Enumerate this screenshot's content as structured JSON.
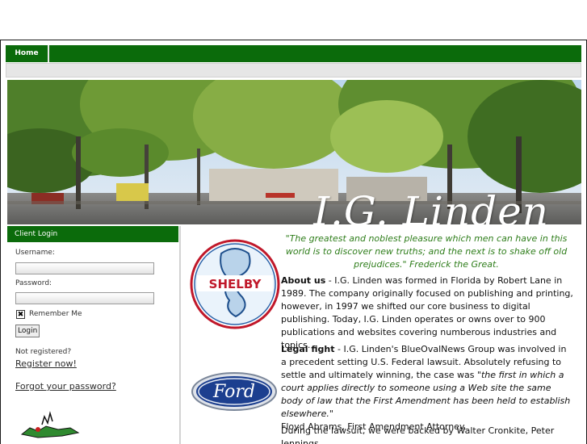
{
  "nav": {
    "home_label": "Home"
  },
  "banner": {
    "title": "I.G. Linden"
  },
  "login": {
    "header": "Client Login",
    "username_label": "Username:",
    "password_label": "Password:",
    "remember_label": "Remember Me",
    "remember_checked": true,
    "login_button": "Login",
    "not_registered": "Not registered?",
    "register_link": "Register now!",
    "forgot_link": "Forgot your password?"
  },
  "content": {
    "quote": "\"The greatest and noblest pleasure which men can have in this world is to discover new truths; and the next is to shake off old prejudices.\" Frederick the Great.",
    "about_heading": "About us",
    "about_text": " - I.G. Linden was formed in Florida by Robert Lane in 1989. The company originally focused on publishing and printing, however, in 1997 we shifted our core business to digital publishing. Today, I.G. Linden operates or owns over to 900 publications and websites covering numberous industries and topics.",
    "legal_heading": "Legal fight",
    "legal_text": " - I.G. Linden's BlueOvalNews Group was involved in a precedent setting U.S. Federal lawsuit. Absolutely refusing to settle and ultimately winning, the case was ",
    "legal_quote": "\"the first in which a court applies directly to someone using a Web site the same body of law that the First Amendment has been held to establish elsewhere.\"",
    "legal_attribution": "Floyd Abrams, First Amendment Attorney.",
    "lawsuit_text": "During the lawsuit, we were backed by Walter Cronkite, Peter Jennings,",
    "shelby_logo_text": "SHELBY",
    "ford_logo_text": "Ford"
  },
  "colors": {
    "nav_green": "#0b6b0b",
    "quote_green": "#2e7d1a"
  },
  "icons": {
    "remember_check": "x-check-icon"
  }
}
